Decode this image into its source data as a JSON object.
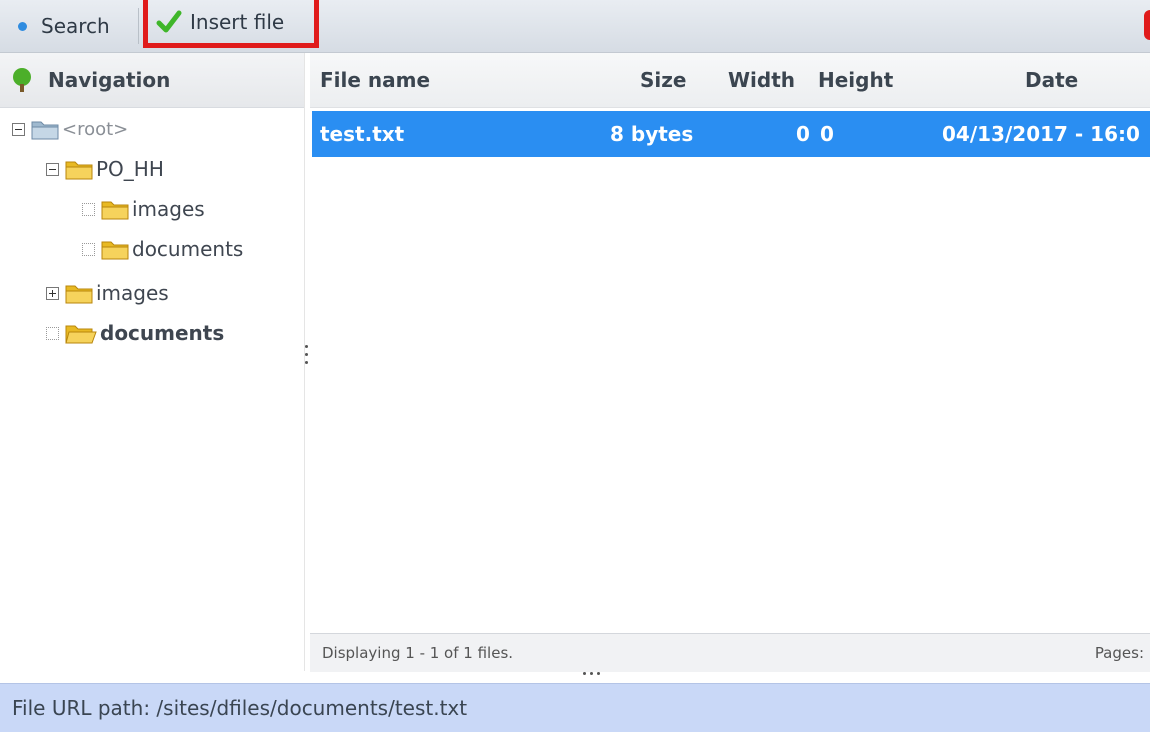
{
  "toolbar": {
    "search_label": "Search",
    "insert_label": "Insert file",
    "icons": {
      "search": "bullet-dot-icon",
      "insert": "check-icon"
    },
    "highlight_color": "#e01b1b"
  },
  "navigation": {
    "title": "Navigation",
    "icon": "tree-icon",
    "tree": [
      {
        "label": "<root>",
        "toggle": "expanded"
      },
      {
        "label": "PO_HH",
        "toggle": "expanded"
      },
      {
        "label": "images",
        "toggle": "leaf"
      },
      {
        "label": "documents",
        "toggle": "leaf"
      },
      {
        "label": "images",
        "toggle": "collapsed"
      },
      {
        "label": "documents",
        "toggle": "leaf",
        "selected": true
      }
    ]
  },
  "grid": {
    "columns": {
      "name": "File name",
      "size": "Size",
      "width": "Width",
      "height": "Height",
      "date": "Date"
    },
    "rows": [
      {
        "name": "test.txt",
        "size": "8 bytes",
        "width": "0",
        "height": "0",
        "date": "04/13/2017 - 16:0"
      }
    ],
    "selected_row_color": "#2a8ef2",
    "footer": {
      "display": "Displaying 1 - 1 of 1 files.",
      "pages": "Pages:"
    }
  },
  "status": {
    "path": "File URL path: /sites/dfiles/documents/test.txt"
  }
}
